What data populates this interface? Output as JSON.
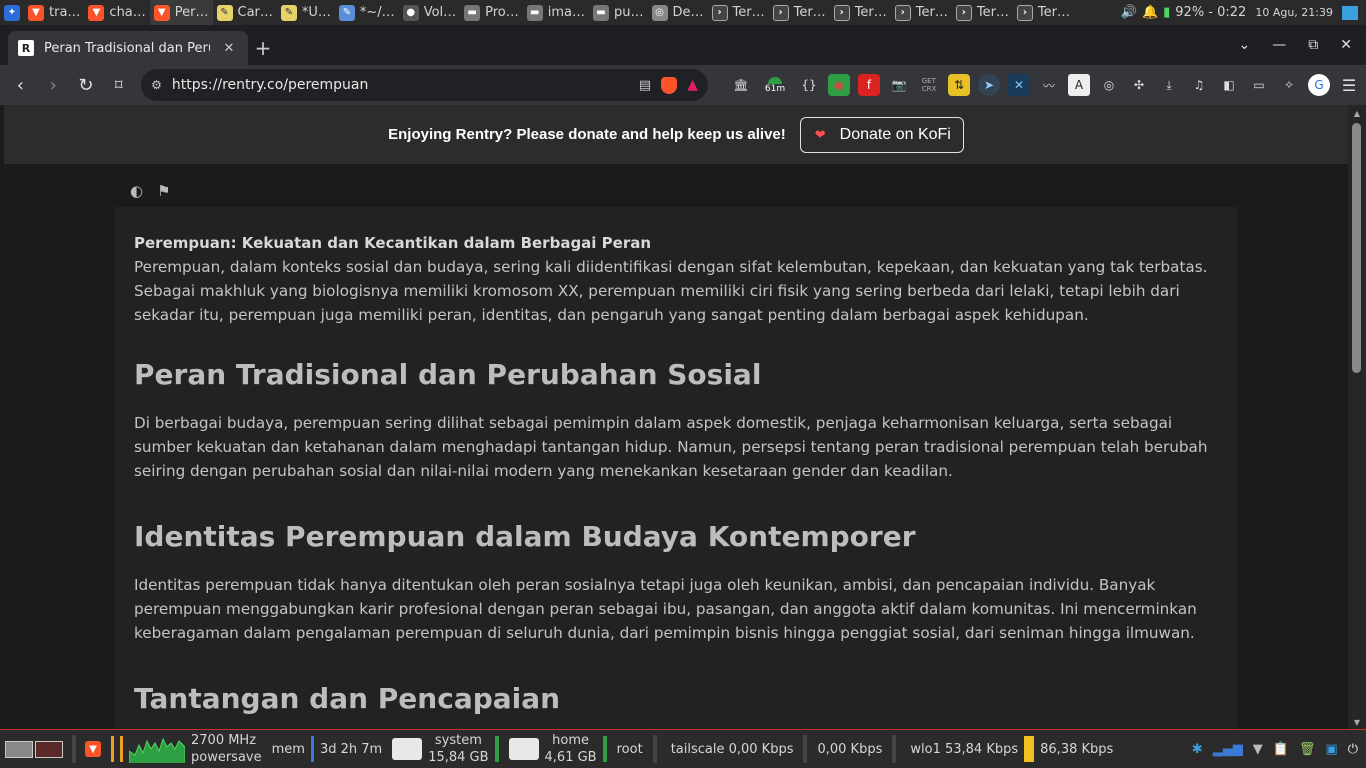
{
  "topbar": {
    "apps": [
      {
        "label": "tra…",
        "icon": "brave-icon"
      },
      {
        "label": "cha…",
        "icon": "brave-icon"
      },
      {
        "label": "Per…",
        "icon": "brave-icon"
      },
      {
        "label": "Car…",
        "icon": "notes-icon"
      },
      {
        "label": "*U…",
        "icon": "notes-icon"
      },
      {
        "label": "*~/…",
        "icon": "editor-icon"
      },
      {
        "label": "Vol…",
        "icon": "volume-app-icon"
      },
      {
        "label": "Pro…",
        "icon": "folder-icon"
      },
      {
        "label": "ima…",
        "icon": "folder-icon"
      },
      {
        "label": "pu…",
        "icon": "folder-icon"
      },
      {
        "label": "De…",
        "icon": "device-icon"
      },
      {
        "label": "Ter…",
        "icon": "terminal-icon"
      },
      {
        "label": "Ter…",
        "icon": "terminal-icon"
      },
      {
        "label": "Ter…",
        "icon": "terminal-icon"
      },
      {
        "label": "Ter…",
        "icon": "terminal-icon"
      },
      {
        "label": "Ter…",
        "icon": "terminal-icon"
      },
      {
        "label": "Ter…",
        "icon": "terminal-icon"
      }
    ],
    "battery": "92% - 0:22",
    "datetime": "10 Agu, 21:39"
  },
  "browser": {
    "tab_title": "Peran Tradisional dan Perub",
    "tab_close": "✕",
    "new_tab": "+",
    "url": "https://rentry.co/perempuan",
    "ext_badge": "61m"
  },
  "banner": {
    "text": "Enjoying Rentry? Please donate and help keep us alive!",
    "button": "Donate on KoFi"
  },
  "article": {
    "title": "Perempuan: Kekuatan dan Kecantikan dalam Berbagai Peran",
    "intro": "Perempuan, dalam konteks sosial dan budaya, sering kali diidentifikasi dengan sifat kelembutan, kepekaan, dan kekuatan yang tak terbatas. Sebagai makhluk yang biologisnya memiliki kromosom XX, perempuan memiliki ciri fisik yang sering berbeda dari lelaki, tetapi lebih dari sekadar itu, perempuan juga memiliki peran, identitas, dan pengaruh yang sangat penting dalam berbagai aspek kehidupan.",
    "sections": [
      {
        "heading": "Peran Tradisional dan Perubahan Sosial",
        "body": "Di berbagai budaya, perempuan sering dilihat sebagai pemimpin dalam aspek domestik, penjaga keharmonisan keluarga, serta sebagai sumber kekuatan dan ketahanan dalam menghadapi tantangan hidup. Namun, persepsi tentang peran tradisional perempuan telah berubah seiring dengan perubahan sosial dan nilai-nilai modern yang menekankan kesetaraan gender dan keadilan."
      },
      {
        "heading": "Identitas Perempuan dalam Budaya Kontemporer",
        "body": "Identitas perempuan tidak hanya ditentukan oleh peran sosialnya tetapi juga oleh keunikan, ambisi, dan pencapaian individu. Banyak perempuan menggabungkan karir profesional dengan peran sebagai ibu, pasangan, dan anggota aktif dalam komunitas. Ini mencerminkan keberagaman dalam pengalaman perempuan di seluruh dunia, dari pemimpin bisnis hingga penggiat sosial, dari seniman hingga ilmuwan."
      },
      {
        "heading": "Tantangan dan Pencapaian",
        "body": ""
      }
    ]
  },
  "bottombar": {
    "cpu_freq": "2700 MHz",
    "cpu_governor": "powersave",
    "mem_label": "mem",
    "uptime": "3d 2h 7m",
    "disk_system_label": "system",
    "disk_system_free": "15,84 GB",
    "disk_home_label": "home",
    "disk_home_free": "4,61 GB",
    "root_label": "root",
    "tailscale": "tailscale 0,00 Kbps",
    "tailscale_up": "0,00 Kbps",
    "wlo1": "wlo1  53,84 Kbps",
    "wlo1_up": "86,38 Kbps"
  }
}
